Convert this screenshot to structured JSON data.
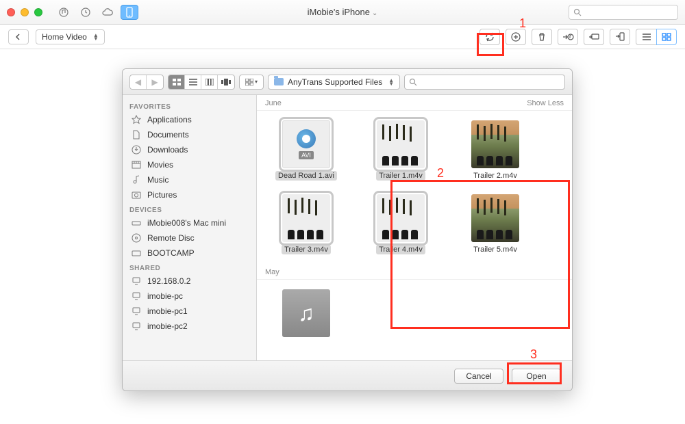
{
  "main": {
    "title": "iMobie's iPhone",
    "breadcrumb": "Home Video",
    "search_placeholder": ""
  },
  "annotations": {
    "n1": "1",
    "n2": "2",
    "n3": "3"
  },
  "dialog": {
    "location": "AnyTrans Supported Files",
    "search_placeholder": "",
    "sidebar": {
      "groups": {
        "favorites": "FAVORITES",
        "devices": "DEVICES",
        "shared": "SHARED"
      },
      "favorites": [
        {
          "label": "Applications"
        },
        {
          "label": "Documents"
        },
        {
          "label": "Downloads"
        },
        {
          "label": "Movies"
        },
        {
          "label": "Music"
        },
        {
          "label": "Pictures"
        }
      ],
      "devices": [
        {
          "label": "iMobie008's Mac mini"
        },
        {
          "label": "Remote Disc"
        },
        {
          "label": "BOOTCAMP"
        }
      ],
      "shared": [
        {
          "label": "192.168.0.2"
        },
        {
          "label": "imobie-pc"
        },
        {
          "label": "imobie-pc1"
        },
        {
          "label": "imobie-pc2"
        }
      ]
    },
    "sections": {
      "june": {
        "title": "June",
        "toggle": "Show Less"
      },
      "may": {
        "title": "May"
      }
    },
    "files_june": [
      {
        "name": "Dead Road 1.avi",
        "type": "avi",
        "selected": true
      },
      {
        "name": "Trailer 1.m4v",
        "type": "movie",
        "selected": true
      },
      {
        "name": "Trailer 2.m4v",
        "type": "movie",
        "selected": false
      },
      {
        "name": "Trailer 3.m4v",
        "type": "movie",
        "selected": true
      },
      {
        "name": "Trailer 4.m4v",
        "type": "movie",
        "selected": true
      },
      {
        "name": "Trailer 5.m4v",
        "type": "movie",
        "selected": false
      }
    ],
    "avi_badge": "AVI",
    "footer": {
      "cancel": "Cancel",
      "open": "Open"
    }
  }
}
